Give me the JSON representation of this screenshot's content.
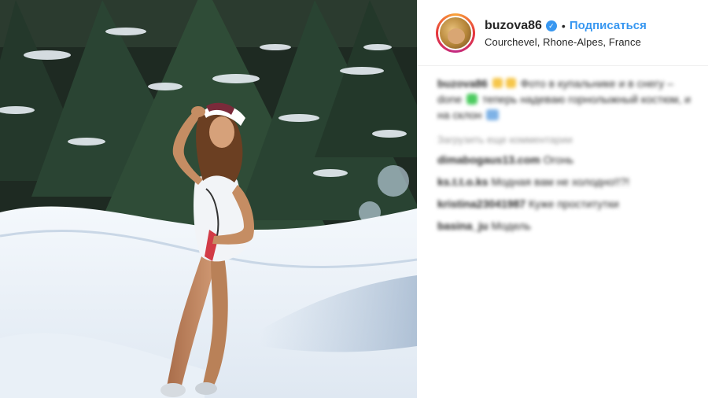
{
  "post": {
    "author": {
      "username": "buzova86",
      "verified_icon": "verified-badge-icon",
      "follow_label": "Подписаться",
      "location": "Courchevel, Rhone-Alpes, France"
    },
    "caption": {
      "username": "buzova86",
      "text_part1": "Фото в купальнике и в снегу – done",
      "text_part2": "теперь надеваю горнолыжный костюм, и на склон"
    },
    "load_more_label": "Загрузить еще комментарии",
    "comments": [
      {
        "username": "dimabogaus13.com",
        "text": "Огонь"
      },
      {
        "username": "ks.t.t.o.ks",
        "text": "Модная вам не холодно!!?!"
      },
      {
        "username": "kristina23041987",
        "text": "Куже проститутки"
      },
      {
        "username": "basina_ju",
        "text": "Модель"
      }
    ]
  },
  "colors": {
    "link_blue": "#3897f0",
    "text": "#262626",
    "muted": "#999999"
  }
}
